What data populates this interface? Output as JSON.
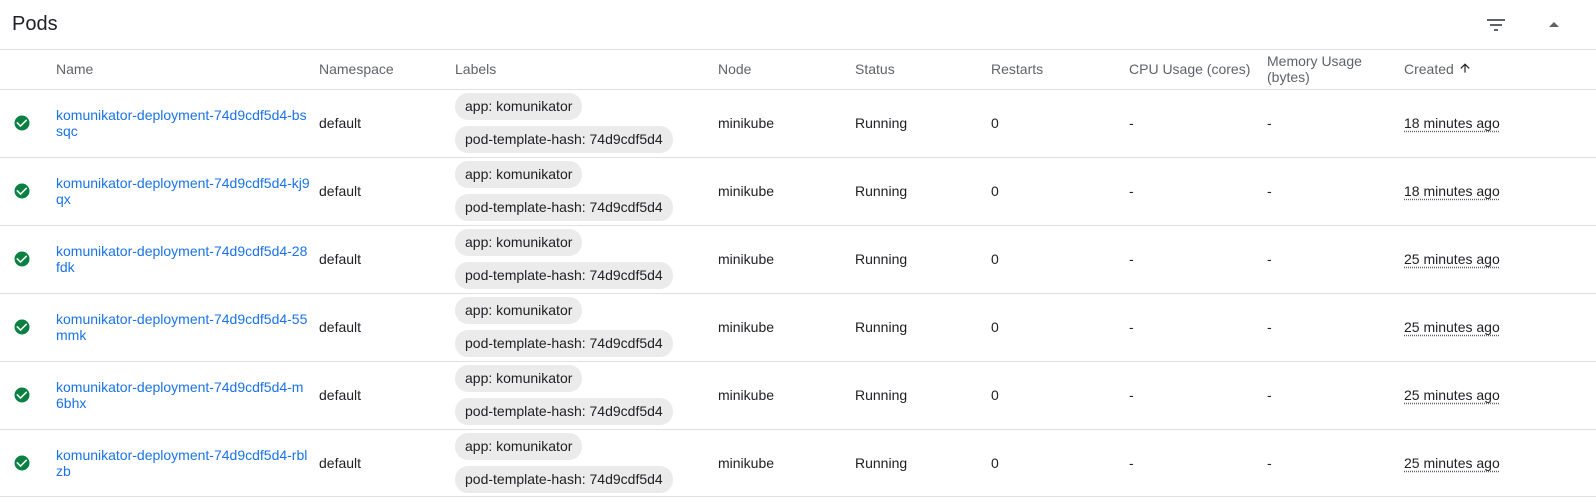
{
  "card": {
    "title": "Pods"
  },
  "icons": {
    "filter": "filter-list-icon",
    "collapse": "arrow-drop-up-icon",
    "status_ok": "check-circle-icon",
    "sort": "arrow-upward-icon",
    "menu": "more-vert-icon"
  },
  "colors": {
    "link": "#1a73e8",
    "status_ok": "#0b8043",
    "chip_bg": "#ebebeb",
    "divider": "#e0e0e0"
  },
  "columns": {
    "name": "Name",
    "namespace": "Namespace",
    "labels": "Labels",
    "node": "Node",
    "status": "Status",
    "restarts": "Restarts",
    "cpu": "CPU Usage (cores)",
    "memory": "Memory Usage (bytes)",
    "created": "Created"
  },
  "pods": [
    {
      "name": "komunikator-deployment-74d9cdf5d4-bssqc",
      "namespace": "default",
      "labels": [
        "app: komunikator",
        "pod-template-hash: 74d9cdf5d4"
      ],
      "node": "minikube",
      "status": "Running",
      "restarts": "0",
      "cpu": "-",
      "memory": "-",
      "created": "18 minutes ago"
    },
    {
      "name": "komunikator-deployment-74d9cdf5d4-kj9qx",
      "namespace": "default",
      "labels": [
        "app: komunikator",
        "pod-template-hash: 74d9cdf5d4"
      ],
      "node": "minikube",
      "status": "Running",
      "restarts": "0",
      "cpu": "-",
      "memory": "-",
      "created": "18 minutes ago"
    },
    {
      "name": "komunikator-deployment-74d9cdf5d4-28fdk",
      "namespace": "default",
      "labels": [
        "app: komunikator",
        "pod-template-hash: 74d9cdf5d4"
      ],
      "node": "minikube",
      "status": "Running",
      "restarts": "0",
      "cpu": "-",
      "memory": "-",
      "created": "25 minutes ago"
    },
    {
      "name": "komunikator-deployment-74d9cdf5d4-55mmk",
      "namespace": "default",
      "labels": [
        "app: komunikator",
        "pod-template-hash: 74d9cdf5d4"
      ],
      "node": "minikube",
      "status": "Running",
      "restarts": "0",
      "cpu": "-",
      "memory": "-",
      "created": "25 minutes ago"
    },
    {
      "name": "komunikator-deployment-74d9cdf5d4-m6bhx",
      "namespace": "default",
      "labels": [
        "app: komunikator",
        "pod-template-hash: 74d9cdf5d4"
      ],
      "node": "minikube",
      "status": "Running",
      "restarts": "0",
      "cpu": "-",
      "memory": "-",
      "created": "25 minutes ago"
    },
    {
      "name": "komunikator-deployment-74d9cdf5d4-rblzb",
      "namespace": "default",
      "labels": [
        "app: komunikator",
        "pod-template-hash: 74d9cdf5d4"
      ],
      "node": "minikube",
      "status": "Running",
      "restarts": "0",
      "cpu": "-",
      "memory": "-",
      "created": "25 minutes ago"
    }
  ]
}
